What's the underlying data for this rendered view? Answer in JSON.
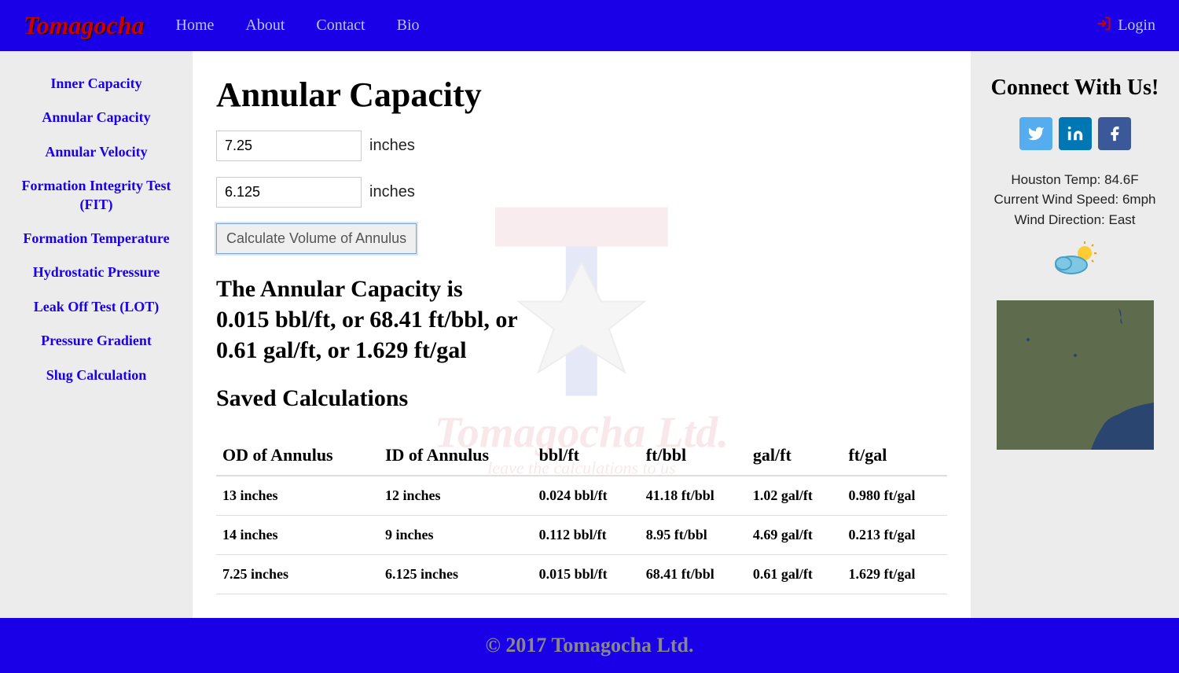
{
  "header": {
    "brand": "Tomagocha",
    "nav": [
      "Home",
      "About",
      "Contact",
      "Bio"
    ],
    "login": "Login"
  },
  "sidebar": {
    "items": [
      "Inner Capacity",
      "Annular Capacity",
      "Annular Velocity",
      "Formation Integrity Test (FIT)",
      "Formation Temperature",
      "Hydrostatic Pressure",
      "Leak Off Test (LOT)",
      "Pressure Gradient",
      "Slug Calculation"
    ]
  },
  "main": {
    "title": "Annular Capacity",
    "input1_value": "7.25",
    "input1_label": "inches",
    "input2_value": "6.125",
    "input2_label": "inches",
    "calc_button": "Calculate Volume of Annulus",
    "result_line1": "The Annular Capacity is",
    "result_line2": "0.015 bbl/ft, or 68.41 ft/bbl, or",
    "result_line3": "0.61 gal/ft, or 1.629 ft/gal",
    "saved_title": "Saved Calculations",
    "table": {
      "headers": [
        "OD of Annulus",
        "ID of Annulus",
        "bbl/ft",
        "ft/bbl",
        "gal/ft",
        "ft/gal"
      ],
      "rows": [
        [
          "13 inches",
          "12 inches",
          "0.024 bbl/ft",
          "41.18 ft/bbl",
          "1.02 gal/ft",
          "0.980 ft/gal"
        ],
        [
          "14 inches",
          "9 inches",
          "0.112 bbl/ft",
          "8.95 ft/bbl",
          "4.69 gal/ft",
          "0.213 ft/gal"
        ],
        [
          "7.25 inches",
          "6.125 inches",
          "0.015 bbl/ft",
          "68.41 ft/bbl",
          "0.61 gal/ft",
          "1.629 ft/gal"
        ]
      ]
    }
  },
  "right": {
    "connect_title": "Connect With Us!",
    "weather_temp": "Houston Temp: 84.6F",
    "weather_wind": "Current Wind Speed: 6mph",
    "weather_dir": "Wind Direction: East"
  },
  "footer": {
    "text": "© 2017 Tomagocha Ltd."
  },
  "watermark": {
    "text": "Tomagocha Ltd.",
    "sub": "leave the calculations to us"
  }
}
